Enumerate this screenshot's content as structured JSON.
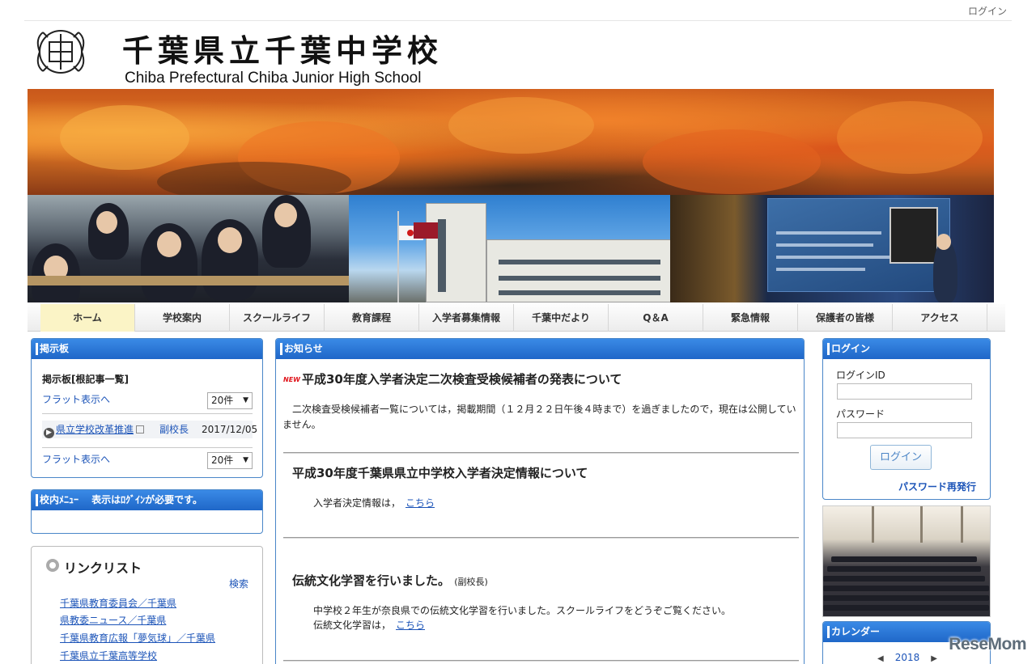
{
  "topbar": {
    "login_link": "ログイン"
  },
  "header": {
    "emblem_text": "中",
    "title_jp": "千葉県立千葉中学校",
    "title_en": "Chiba Prefectural Chiba Junior High School"
  },
  "nav": {
    "items": [
      "ホーム",
      "学校案内",
      "スクールライフ",
      "教育課程",
      "入学者募集情報",
      "千葉中だより",
      "Q＆A",
      "緊急情報",
      "保護者の皆様",
      "アクセス"
    ]
  },
  "bbs": {
    "heading": "掲示板",
    "title": "掲示板[根記事一覧]",
    "flat_link": "フラット表示へ",
    "per_page": "20件",
    "row": {
      "title": "県立学校改革推進",
      "author": "副校長",
      "date": "2017/12/05"
    }
  },
  "school_menu": {
    "heading": "校内ﾒﾆｭｰ　 表示はﾛｸﾞｲﾝが必要です。"
  },
  "links": {
    "heading": "リンクリスト",
    "search": "検索",
    "items": [
      "千葉県教育委員会／千葉県",
      "県教委ニュース／千葉県",
      "千葉県教育広報「夢気球」／千葉県",
      "千葉県立千葉高等学校"
    ]
  },
  "news": {
    "heading": "お知らせ",
    "new_badge": "NEW",
    "item1": {
      "title": "平成30年度入学者決定二次検査受検候補者の発表について",
      "body": "　二次検査受検候補者一覧については，掲載期間（１２月２２日午後４時まで）を過ぎましたので，現在は公開していません。"
    },
    "item2": {
      "title": "平成30年度千葉県県立中学校入学者決定情報について",
      "body": "入学者決定情報は，",
      "link": "こちら"
    },
    "item3": {
      "title": "伝統文化学習を行いました。",
      "author": "(副校長)",
      "body": "中学校２年生が奈良県での伝統文化学習を行いました。スクールライフをどうぞご覧ください。",
      "body2": "伝統文化学習は，",
      "link": "こちら"
    }
  },
  "login": {
    "heading": "ログイン",
    "id_label": "ログインID",
    "password_label": "パスワード",
    "button": "ログイン",
    "reissue": "パスワード再発行"
  },
  "calendar": {
    "heading": "カレンダー",
    "year": "2018",
    "prev": "◀",
    "next": "▶"
  },
  "watermark": "ReseMom"
}
